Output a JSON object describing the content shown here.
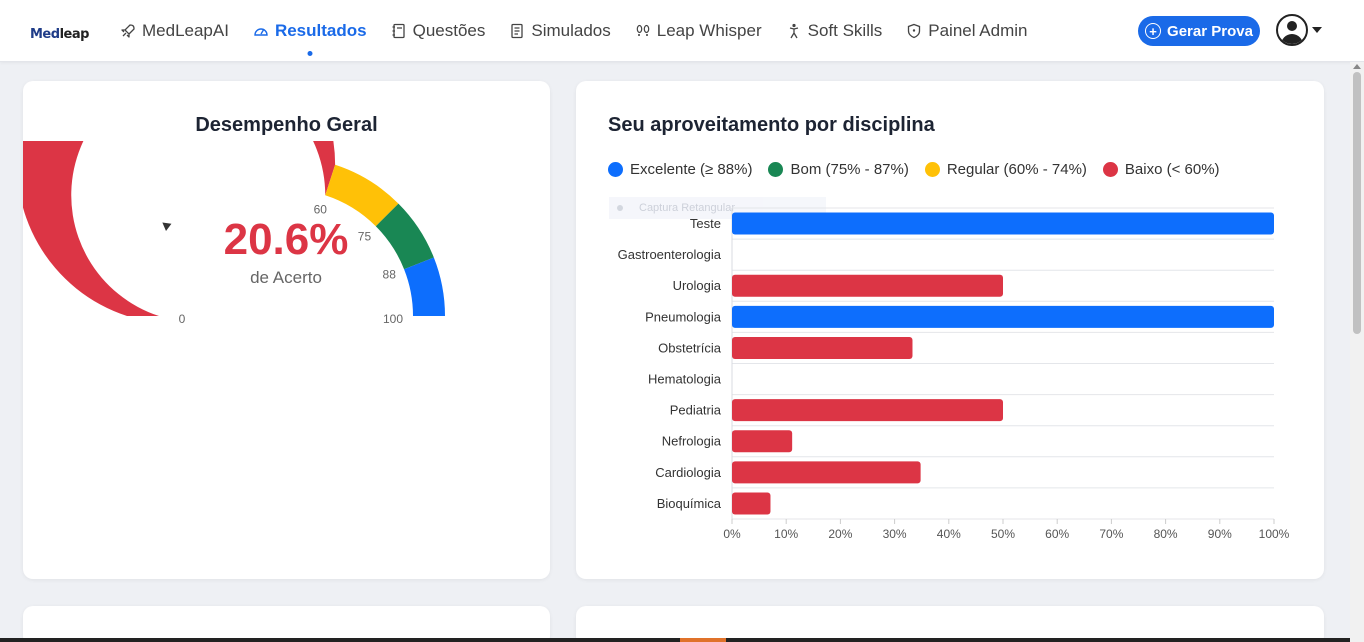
{
  "logo": {
    "text_a": "Med",
    "text_b": "leap"
  },
  "nav": {
    "items": [
      {
        "label": "MedLeapAI",
        "icon": "rocket-icon",
        "active": false
      },
      {
        "label": "Resultados",
        "icon": "gauge-icon",
        "active": true
      },
      {
        "label": "Questões",
        "icon": "notebook-icon",
        "active": false
      },
      {
        "label": "Simulados",
        "icon": "document-icon",
        "active": false
      },
      {
        "label": "Leap Whisper",
        "icon": "footprints-icon",
        "active": false
      },
      {
        "label": "Soft Skills",
        "icon": "person-icon",
        "active": false
      },
      {
        "label": "Painel Admin",
        "icon": "shield-icon",
        "active": false
      }
    ],
    "cta_label": "Gerar Prova",
    "accent": "#1a6ae8"
  },
  "gauge": {
    "title": "Desempenho Geral",
    "value_text": "20.6%",
    "value": 20.6,
    "caption": "de Acerto",
    "ticks": [
      "0",
      "60",
      "75",
      "88",
      "100"
    ],
    "tick_values": [
      0,
      60,
      75,
      88,
      100
    ],
    "segments": [
      {
        "from": 0,
        "to": 60,
        "color": "#dc3545"
      },
      {
        "from": 60,
        "to": 75,
        "color": "#ffc107"
      },
      {
        "from": 75,
        "to": 88,
        "color": "#198754"
      },
      {
        "from": 88,
        "to": 100,
        "color": "#0d6efd"
      }
    ],
    "value_color": "#dc3545"
  },
  "chart_panel": {
    "title": "Seu aproveitamento por disciplina",
    "legend": [
      {
        "label": "Excelente (≥ 88%)",
        "color": "#0d6efd"
      },
      {
        "label": "Bom (75% - 87%)",
        "color": "#198754"
      },
      {
        "label": "Regular (60% - 74%)",
        "color": "#ffc107"
      },
      {
        "label": "Baixo (< 60%)",
        "color": "#dc3545"
      }
    ],
    "overlay_text": "Captura Retangular"
  },
  "chart_data": {
    "type": "bar",
    "orientation": "horizontal",
    "categories": [
      "Teste",
      "Gastroenterologia",
      "Urologia",
      "Pneumologia",
      "Obstetrícia",
      "Hematologia",
      "Pediatria",
      "Nefrologia",
      "Cardiologia",
      "Bioquímica"
    ],
    "values": [
      100,
      0,
      50,
      100,
      33.3,
      0,
      50,
      11.1,
      34.8,
      7.1
    ],
    "colors": [
      "#0d6efd",
      "#dc3545",
      "#dc3545",
      "#0d6efd",
      "#dc3545",
      "#dc3545",
      "#dc3545",
      "#dc3545",
      "#dc3545",
      "#dc3545"
    ],
    "x_ticks": [
      "0%",
      "10%",
      "20%",
      "30%",
      "40%",
      "50%",
      "60%",
      "70%",
      "80%",
      "90%",
      "100%"
    ],
    "xlim": [
      0,
      100
    ],
    "grid": true
  }
}
